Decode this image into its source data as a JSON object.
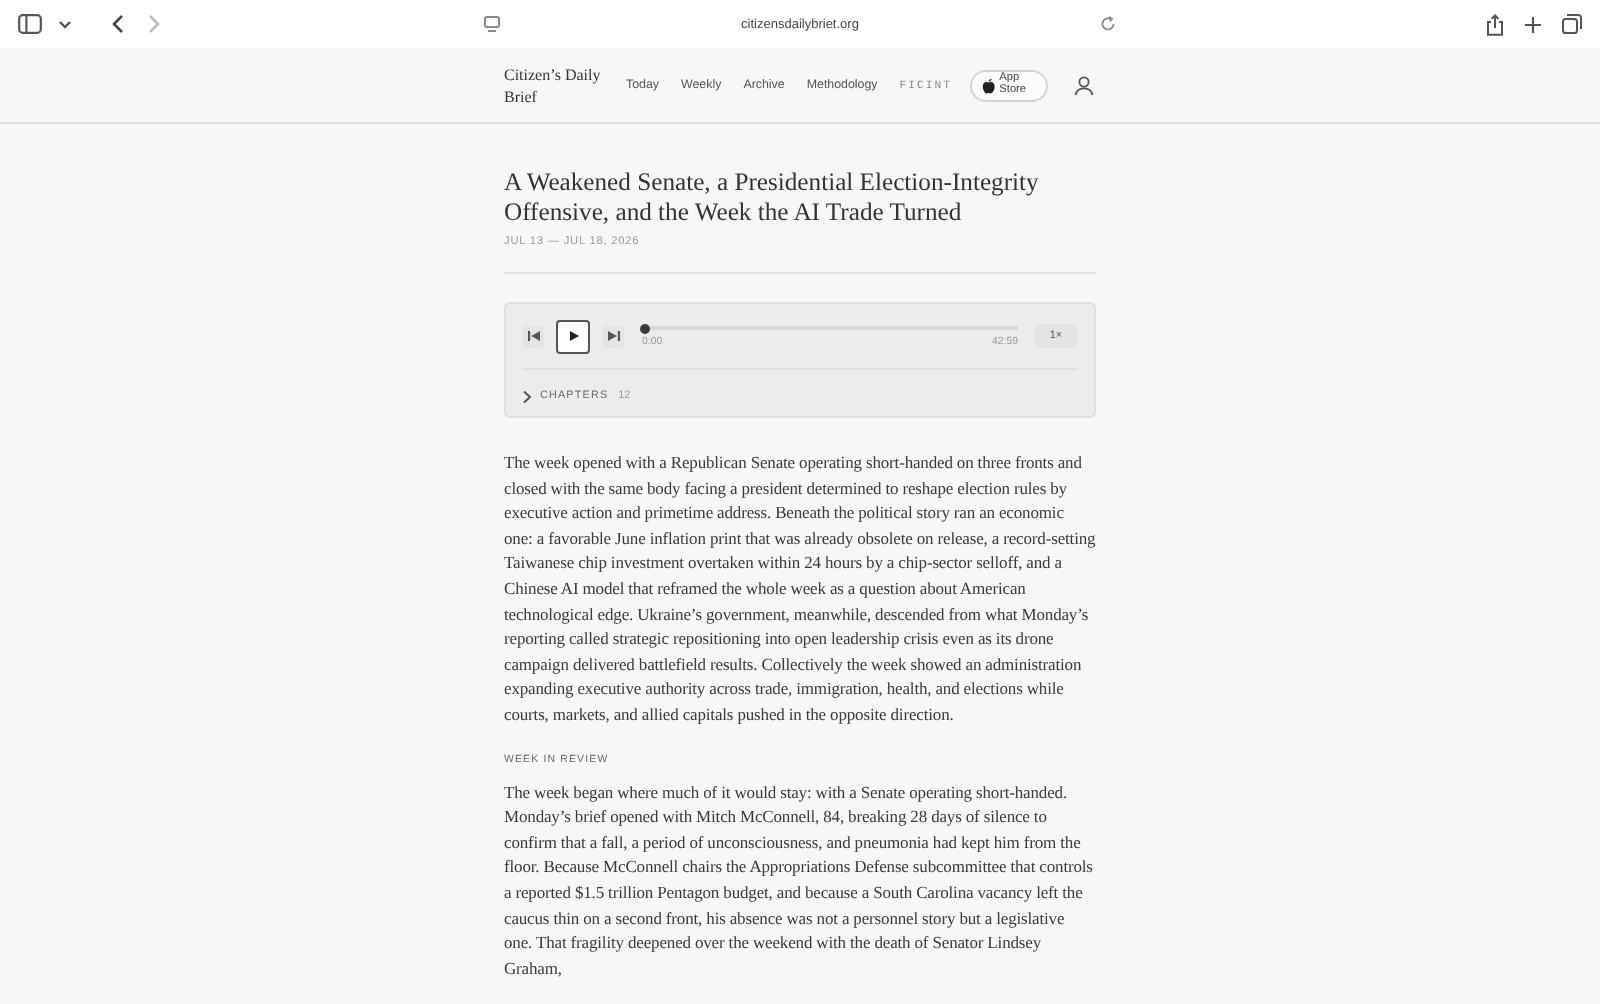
{
  "browser": {
    "url": "citizensdailybriet.org"
  },
  "site_header": {
    "logo": "Citizen’s Daily Brief",
    "nav": [
      {
        "label": "Today",
        "kind": "link"
      },
      {
        "label": "Weekly",
        "kind": "link"
      },
      {
        "label": "Archive",
        "kind": "link"
      },
      {
        "label": "Methodology",
        "kind": "link"
      },
      {
        "label": "FICINT",
        "kind": "mono"
      }
    ],
    "app_button": "App Store"
  },
  "article": {
    "title": "A Weakened Senate, a Presidential Election-Integrity Offensive, and the Week the AI Trade Turned",
    "dates": "JUL 13 — JUL 18, 2026",
    "player": {
      "level": 0,
      "elapsed": "0:00",
      "duration": "42:59",
      "speed": "1×",
      "chapters_label": "CHAPTERS",
      "chapters_count": "12",
      "expanded": false
    },
    "intro": "The week opened with a Republican Senate operating short-handed on three fronts and closed with the same body facing a president determined to reshape election rules by executive action and primetime address. Beneath the political story ran an economic one: a favorable June inflation print that was already obsolete on release, a record-setting Taiwanese chip investment overtaken within 24 hours by a chip-sector selloff, and a Chinese AI model that reframed the whole week as a question about American technological edge. Ukraine’s government, meanwhile, descended from what Monday’s reporting called strategic repositioning into open leadership crisis even as its drone campaign delivered battlefield results. Collectively the week showed an administration expanding executive authority across trade, immigration, health, and elections while courts, markets, and allied capitals pushed in the opposite direction.",
    "section_heading": "WEEK IN REVIEW",
    "section_text": "The week began where much of it would stay: with a Senate operating short-handed. Monday’s brief opened with Mitch McConnell, 84, breaking 28 days of silence to confirm that a fall, a period of unconsciousness, and pneumonia had kept him from the floor. Because McConnell chairs the Appropriations Defense subcommittee that controls a reported $1.5 trillion Pentagon budget, and because a South Carolina vacancy left the caucus thin on a second front, his absence was not a personnel story but a legislative one. That fragility deepened over the weekend with the death of Senator Lindsey Graham,"
  }
}
